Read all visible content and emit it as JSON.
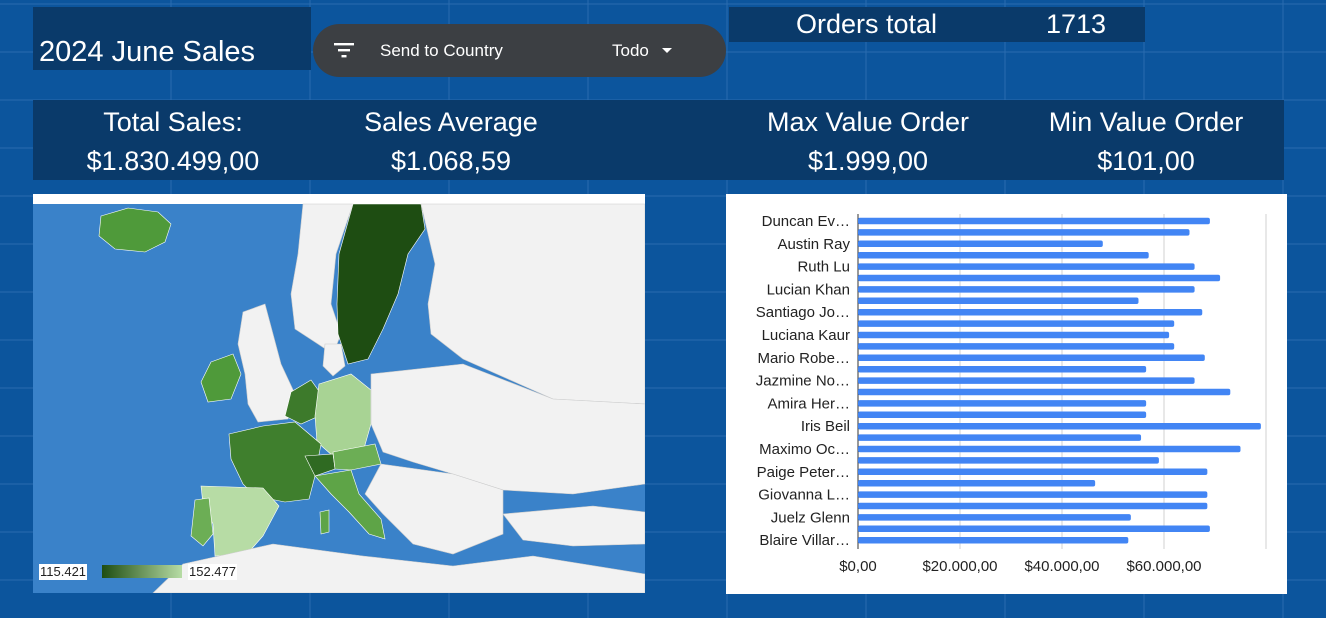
{
  "dashboard": {
    "title": "2024 June Sales"
  },
  "filter": {
    "label": "Send to Country",
    "value": "Todo",
    "icon": "filter-list-icon"
  },
  "orders": {
    "label": "Orders total",
    "value": "1713"
  },
  "kpis": [
    {
      "label": "Total Sales:",
      "value": "$1.830.499,00"
    },
    {
      "label": "Sales Average",
      "value": "$1.068,59"
    },
    {
      "label": "Max Value Order",
      "value": "$1.999,00"
    },
    {
      "label": "Min Value Order",
      "value": "$101,00"
    }
  ],
  "colors": {
    "background": "#0c559d",
    "panel": "#0a3a6a",
    "bar": "#4285f4",
    "map_dark": "#1e4d12",
    "map_light": "#b7dca5",
    "sea": "#3a82c9",
    "no_data_land": "#f2f2f2"
  },
  "chart_data": [
    {
      "type": "heatmap",
      "subtype": "geo-choropleth",
      "region": "Europe",
      "legend": {
        "min": "115.421",
        "max": "152.477"
      },
      "shaded_countries_note_levels": [
        {
          "country": "Sweden",
          "level": "darkest"
        },
        {
          "country": "France",
          "level": "dark"
        },
        {
          "country": "Netherlands",
          "level": "dark"
        },
        {
          "country": "Belgium",
          "level": "dark"
        },
        {
          "country": "Ireland",
          "level": "mid"
        },
        {
          "country": "Iceland",
          "level": "mid"
        },
        {
          "country": "Switzerland",
          "level": "dark"
        },
        {
          "country": "Austria",
          "level": "mid-light"
        },
        {
          "country": "Italy",
          "level": "mid"
        },
        {
          "country": "Germany",
          "level": "light"
        },
        {
          "country": "Spain",
          "level": "lightest"
        },
        {
          "country": "Portugal",
          "level": "mid"
        }
      ]
    },
    {
      "type": "bar",
      "orientation": "horizontal",
      "categories": [
        "Duncan Ev…",
        "",
        "Austin Ray",
        "",
        "Ruth Lu",
        "",
        "Lucian Khan",
        "",
        "Santiago Jo…",
        "",
        "Luciana Kaur",
        "",
        "Mario Robe…",
        "",
        "Jazmine No…",
        "",
        "Amira Her…",
        "",
        "Iris Beil",
        "",
        "Maximo Oc…",
        "",
        "Paige Peter…",
        "",
        "Giovanna L…",
        "",
        "Juelz Glenn",
        "",
        "Blaire Villar…"
      ],
      "values": [
        69000,
        65000,
        48000,
        57000,
        66000,
        71000,
        66000,
        55000,
        67500,
        62000,
        61000,
        62000,
        68000,
        56500,
        66000,
        73000,
        56500,
        56500,
        79000,
        55500,
        75000,
        59000,
        68500,
        46500,
        68500,
        68500,
        53500,
        69000,
        53000
      ],
      "x_ticks": [
        "$0,00",
        "$20.000,00",
        "$40.000,00",
        "$60.000,00"
      ],
      "xlim": [
        0,
        80000
      ]
    }
  ]
}
